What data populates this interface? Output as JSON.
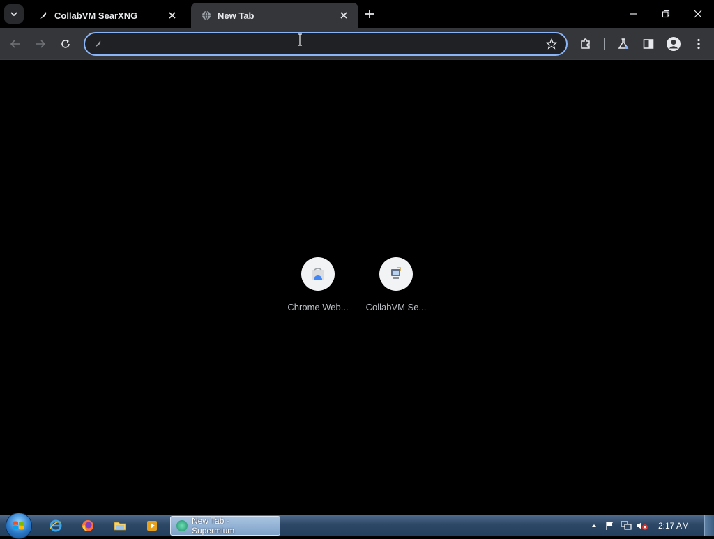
{
  "browser": {
    "tabs": [
      {
        "title": "CollabVM SearXNG",
        "active": false
      },
      {
        "title": "New Tab",
        "active": true
      }
    ],
    "omnibox": {
      "value": "",
      "placeholder": ""
    }
  },
  "ntp": {
    "shortcuts": [
      {
        "label": "Chrome Web..."
      },
      {
        "label": "CollabVM Se..."
      }
    ]
  },
  "taskbar": {
    "task_label": "New Tab - Supermium",
    "clock": "2:17 AM"
  },
  "colors": {
    "omnibox_focus": "#8ab4f8",
    "active_tab": "#35363a",
    "background": "#000000"
  }
}
